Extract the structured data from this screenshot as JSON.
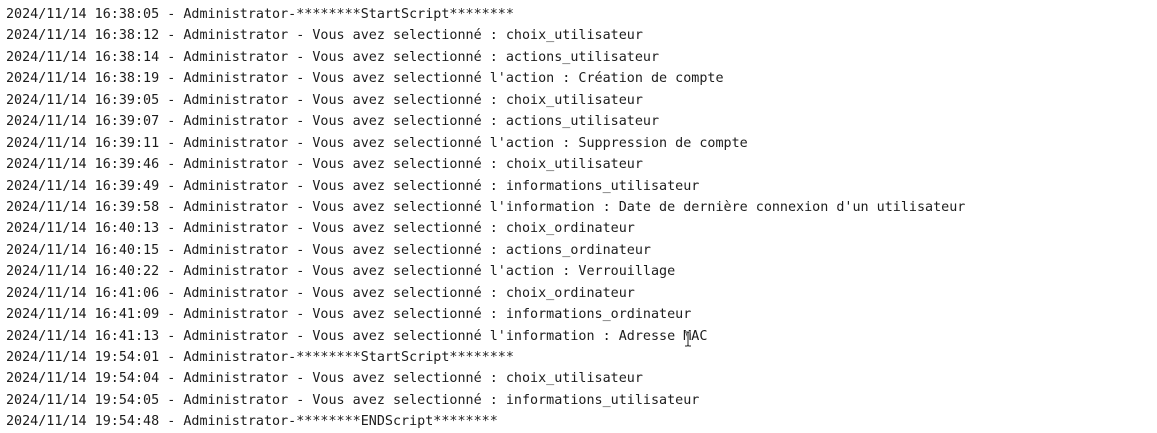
{
  "log": {
    "lines": [
      "2024/11/14 16:38:05 - Administrator-********StartScript********",
      "2024/11/14 16:38:12 - Administrator - Vous avez selectionné : choix_utilisateur",
      "2024/11/14 16:38:14 - Administrator - Vous avez selectionné : actions_utilisateur",
      "2024/11/14 16:38:19 - Administrator - Vous avez selectionné l'action : Création de compte",
      "2024/11/14 16:39:05 - Administrator - Vous avez selectionné : choix_utilisateur",
      "2024/11/14 16:39:07 - Administrator - Vous avez selectionné : actions_utilisateur",
      "2024/11/14 16:39:11 - Administrator - Vous avez selectionné l'action : Suppression de compte",
      "2024/11/14 16:39:46 - Administrator - Vous avez selectionné : choix_utilisateur",
      "2024/11/14 16:39:49 - Administrator - Vous avez selectionné : informations_utilisateur",
      "2024/11/14 16:39:58 - Administrator - Vous avez selectionné l'information : Date de dernière connexion d'un utilisateur",
      "2024/11/14 16:40:13 - Administrator - Vous avez selectionné : choix_ordinateur",
      "2024/11/14 16:40:15 - Administrator - Vous avez selectionné : actions_ordinateur",
      "2024/11/14 16:40:22 - Administrator - Vous avez selectionné l'action : Verrouillage",
      "2024/11/14 16:41:06 - Administrator - Vous avez selectionné : choix_ordinateur",
      "2024/11/14 16:41:09 - Administrator - Vous avez selectionné : informations_ordinateur",
      "2024/11/14 16:41:13 - Administrator - Vous avez selectionné l'information : Adresse MAC",
      "2024/11/14 19:54:01 - Administrator-********StartScript********",
      "2024/11/14 19:54:04 - Administrator - Vous avez selectionné : choix_utilisateur",
      "2024/11/14 19:54:05 - Administrator - Vous avez selectionné : informations_utilisateur",
      "2024/11/14 19:54:48 - Administrator-********ENDScript********"
    ]
  },
  "cursor": {
    "icon": "text-cursor-icon"
  }
}
